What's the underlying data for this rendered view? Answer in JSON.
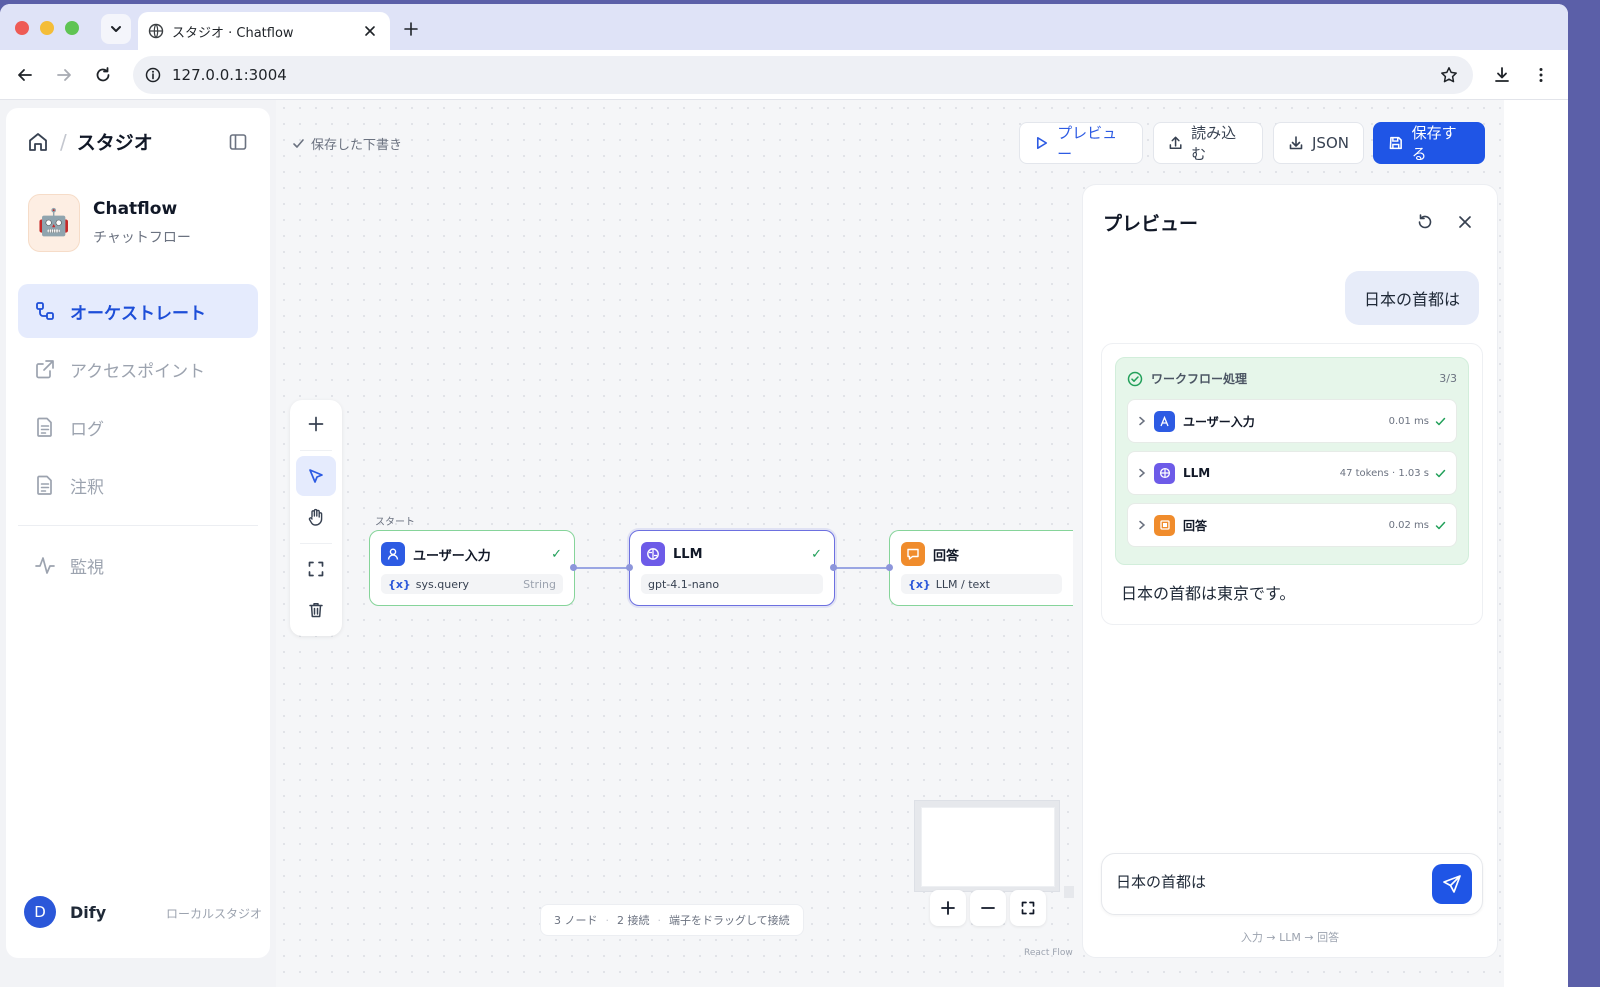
{
  "browser": {
    "tab_title": "スタジオ · Chatflow",
    "url": "127.0.0.1:3004"
  },
  "sidebar": {
    "breadcrumb_title": "スタジオ",
    "app_name": "Chatflow",
    "app_type": "チャットフロー",
    "nav": [
      {
        "label": "オーケストレート",
        "icon": "orchestrate-icon",
        "active": true
      },
      {
        "label": "アクセスポイント",
        "icon": "external-link-icon",
        "active": false
      },
      {
        "label": "ログ",
        "icon": "document-icon",
        "active": false
      },
      {
        "label": "注釈",
        "icon": "document-icon",
        "active": false
      },
      {
        "label": "監視",
        "icon": "activity-icon",
        "active": false
      }
    ],
    "user": {
      "initial": "D",
      "name": "Dify",
      "workspace": "ローカルスタジオ"
    }
  },
  "canvas": {
    "saved_status": "保存した下書き",
    "buttons": {
      "preview": "プレビュー",
      "import": "読み込む",
      "json": "JSON",
      "save": "保存する"
    },
    "start_label": "スタート",
    "nodes": [
      {
        "title": "ユーザー入力",
        "var": "{x}",
        "field": "sys.query",
        "type": "String",
        "icon_color": "#2d5be3",
        "status": "✓"
      },
      {
        "title": "LLM",
        "field": "gpt-4.1-nano",
        "icon_color": "#6d5be8",
        "status": "✓"
      },
      {
        "title": "回答",
        "var": "{x}",
        "field": "LLM / text",
        "icon_color": "#f08c2c",
        "status": "✓"
      }
    ],
    "status_bar": {
      "nodes": "3 ノード",
      "edges": "2 接続",
      "hint": "端子をドラッグして接続"
    },
    "react_flow_label": "React Flow"
  },
  "preview": {
    "title": "プレビュー",
    "user_message": "日本の首都は",
    "workflow": {
      "title": "ワークフロー処理",
      "count": "3/3",
      "steps": [
        {
          "name": "ユーザー入力",
          "meta": "0.01 ms",
          "icon_color": "#2d5be3"
        },
        {
          "name": "LLM",
          "meta": "47 tokens · 1.03 s",
          "icon_color": "#6d5be8"
        },
        {
          "name": "回答",
          "meta": "0.02 ms",
          "icon_color": "#f08c2c"
        }
      ]
    },
    "answer": "日本の首都は東京です。",
    "input_value": "日本の首都は",
    "footer": "入力 → LLM → 回答"
  }
}
